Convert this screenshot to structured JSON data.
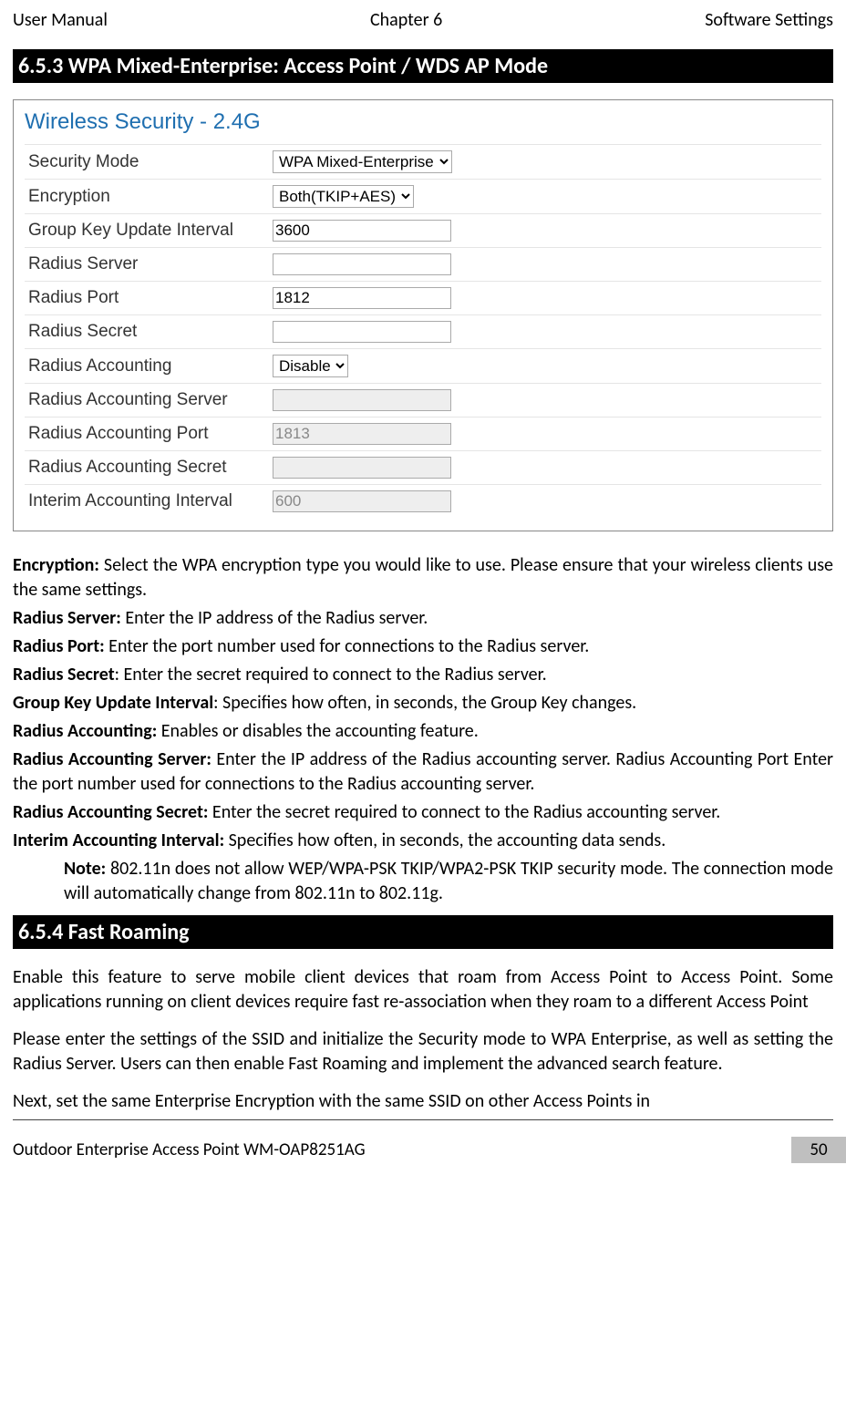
{
  "header": {
    "left": "User Manual",
    "center": "Chapter 6",
    "right": "Software Settings"
  },
  "section1": {
    "title": "6.5.3 WPA Mixed-Enterprise: Access Point / WDS AP Mode"
  },
  "panel": {
    "title": "Wireless Security - 2.4G",
    "rows": {
      "security_mode": {
        "label": "Security Mode",
        "value": "WPA Mixed-Enterprise"
      },
      "encryption": {
        "label": "Encryption",
        "value": "Both(TKIP+AES)"
      },
      "gkui": {
        "label": "Group Key Update Interval",
        "value": "3600"
      },
      "radius_server": {
        "label": "Radius Server",
        "value": ""
      },
      "radius_port": {
        "label": "Radius Port",
        "value": "1812"
      },
      "radius_secret": {
        "label": "Radius Secret",
        "value": ""
      },
      "radius_acct": {
        "label": "Radius Accounting",
        "value": "Disable"
      },
      "radius_acct_server": {
        "label": "Radius Accounting Server",
        "value": ""
      },
      "radius_acct_port": {
        "label": "Radius Accounting Port",
        "value": "1813"
      },
      "radius_acct_secret": {
        "label": "Radius Accounting Secret",
        "value": ""
      },
      "interim": {
        "label": "Interim Accounting Interval",
        "value": "600"
      }
    }
  },
  "defs": {
    "encryption": {
      "b": "Encryption:",
      "t": " Select the WPA encryption type you would like to use. Please ensure that your wireless clients use the same settings."
    },
    "radius_server": {
      "b": "Radius Server:",
      "t": " Enter the IP address of the Radius server."
    },
    "radius_port": {
      "b": "Radius Port:",
      "t": " Enter the port number used for connections to the Radius server."
    },
    "radius_secret": {
      "b": "Radius Secret",
      "t": ": Enter the secret required to connect to the Radius server."
    },
    "gkui": {
      "b": "Group Key Update Interval",
      "t": ": Specifies how often, in seconds, the Group Key changes."
    },
    "radius_acct": {
      "b": "Radius Accounting:",
      "t": " Enables or disables the accounting feature."
    },
    "radius_acct_server": {
      "b": "Radius Accounting Server:",
      "t": " Enter the IP address of the Radius accounting server. Radius Accounting Port Enter the port number used for connections to the Radius accounting server."
    },
    "radius_acct_secret": {
      "b": "Radius Accounting Secret:",
      "t": " Enter the secret required to connect to the Radius accounting server."
    },
    "interim": {
      "b": "Interim Accounting Interval:",
      "t": " Specifies how often, in seconds, the accounting data sends."
    },
    "note": {
      "b": "Note:",
      "t": " 802.11n does not allow WEP/WPA-PSK TKIP/WPA2-PSK TKIP security mode. The connection mode will automatically change from 802.11n to 802.11g."
    }
  },
  "section2": {
    "title": "6.5.4 Fast Roaming",
    "p1": "Enable this feature to serve mobile client devices that roam from Access Point to Access Point. Some applications running on client devices require fast re-association when they roam to a different Access Point",
    "p2": "Please enter the settings of the SSID and initialize the Security mode to WPA Enterprise, as well as setting the Radius Server. Users can then enable Fast Roaming and implement the advanced search feature.",
    "p3": "Next, set the same Enterprise Encryption with the same SSID on other Access Points in"
  },
  "footer": {
    "left": "Outdoor Enterprise Access Point WM-OAP8251AG",
    "right": "50"
  }
}
